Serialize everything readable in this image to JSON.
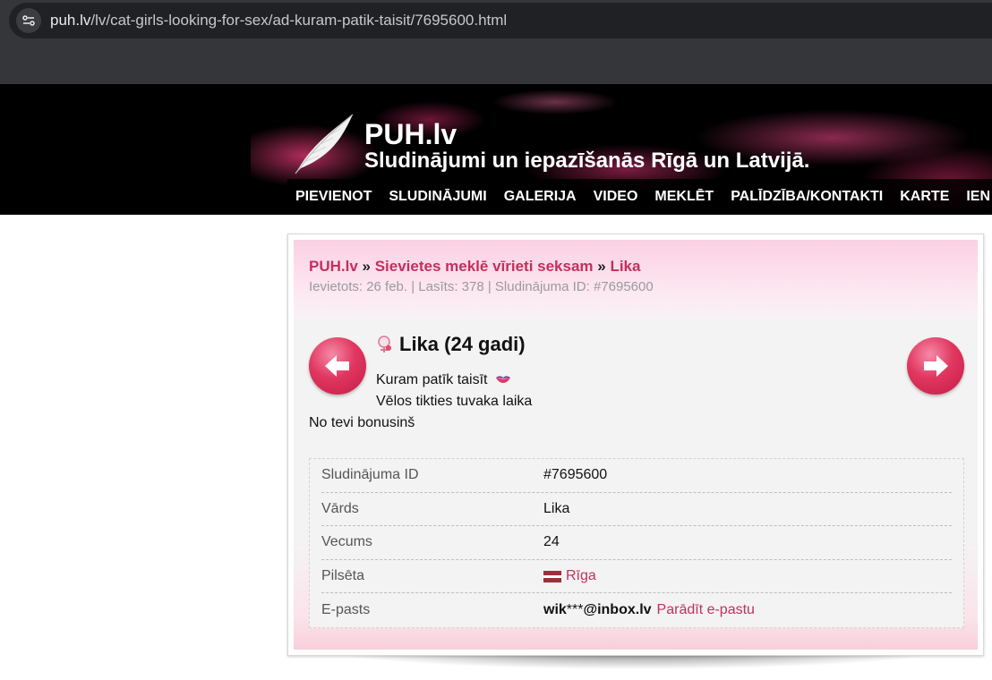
{
  "browser": {
    "url_host": "puh.lv",
    "url_path": "/lv/cat-girls-looking-for-sex/ad-kuram-patik-taisit/7695600.html"
  },
  "header": {
    "title": "PUH.lv",
    "subtitle": "Sludinājumi un iepazīšanās Rīgā un Latvijā.",
    "nav": [
      "PIEVIENOT",
      "SLUDINĀJUMI",
      "GALERIJA",
      "VIDEO",
      "MEKLĒT",
      "PALĪDZĪBA/KONTAKTI",
      "KARTE",
      "IEN"
    ]
  },
  "breadcrumb": {
    "home": "PUH.lv",
    "sep1": " » ",
    "category": "Sievietes meklē vīrieti seksam",
    "sep2": " » ",
    "current": "Lika"
  },
  "meta": "Ievietots: 26 feb. | Lasīts: 378 | Sludinājuma ID: #7695600",
  "ad": {
    "title": "Lika (24 gadi)",
    "line1": "Kuram patīk taisīt",
    "line2": "Vēlos tikties tuvaka laika",
    "line3": "No tevi bonusinš"
  },
  "details": {
    "id_label": "Sludinājuma ID",
    "id_value": "#7695600",
    "name_label": "Vārds",
    "name_value": "Lika",
    "age_label": "Vecums",
    "age_value": "24",
    "city_label": "Pilsēta",
    "city_value": "Rīga",
    "email_label": "E-pasts",
    "email_user": "wik",
    "email_mask": "***",
    "email_domain": "@inbox.lv",
    "email_link": "Parādīt e-pastu"
  },
  "colors": {
    "accent": "#c2305c",
    "header_bg": "#000000",
    "panel_bg": "#f3f3f3"
  }
}
